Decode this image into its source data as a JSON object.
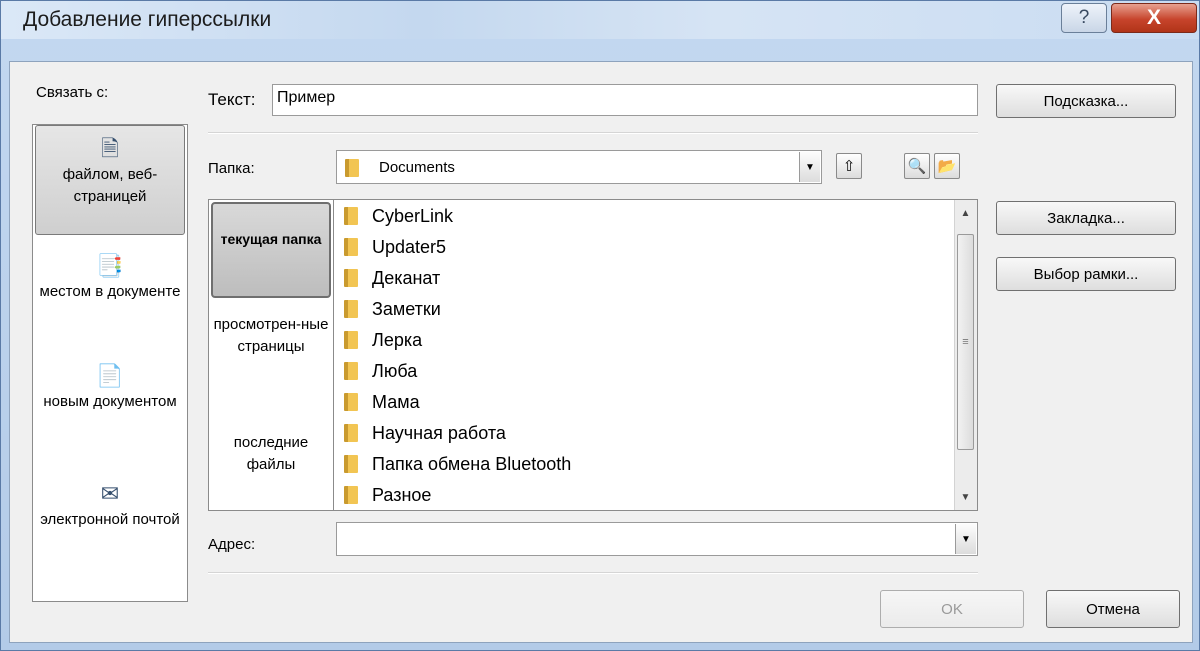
{
  "window": {
    "title": "Добавление гиперссылки",
    "help_glyph": "?",
    "close_glyph": "X"
  },
  "link_to": {
    "label": "Связать с:",
    "items": [
      {
        "label": "файлом, веб-страницей",
        "icon": "file-web-icon",
        "selected": true
      },
      {
        "label": "местом в документе",
        "icon": "place-in-document-icon",
        "selected": false
      },
      {
        "label": "новым документом",
        "icon": "new-document-icon",
        "selected": false
      },
      {
        "label": "электронной почтой",
        "icon": "email-icon",
        "selected": false
      }
    ]
  },
  "text_field": {
    "label": "Текст:",
    "value": "Пример"
  },
  "buttons": {
    "screentip": "Подсказка...",
    "bookmark": "Закладка...",
    "target_frame": "Выбор рамки...",
    "ok": "OK",
    "cancel": "Отмена"
  },
  "folder": {
    "label": "Папка:",
    "value": "Documents"
  },
  "places": [
    {
      "label": "текущая папка",
      "selected": true
    },
    {
      "label": "просмотрен-ные страницы",
      "selected": false
    },
    {
      "label": "последние файлы",
      "selected": false
    }
  ],
  "files": [
    "CyberLink",
    "Updater5",
    "Деканат",
    "Заметки",
    "Лерка",
    "Люба",
    "Мама",
    "Научная работа",
    "Папка обмена Bluetooth",
    "Разное"
  ],
  "address": {
    "label": "Адрес:",
    "value": ""
  },
  "colors": {
    "title_bar": "#c4d8ef",
    "close_button": "#c7442c",
    "dialog_bg": "#f0f0f0"
  }
}
